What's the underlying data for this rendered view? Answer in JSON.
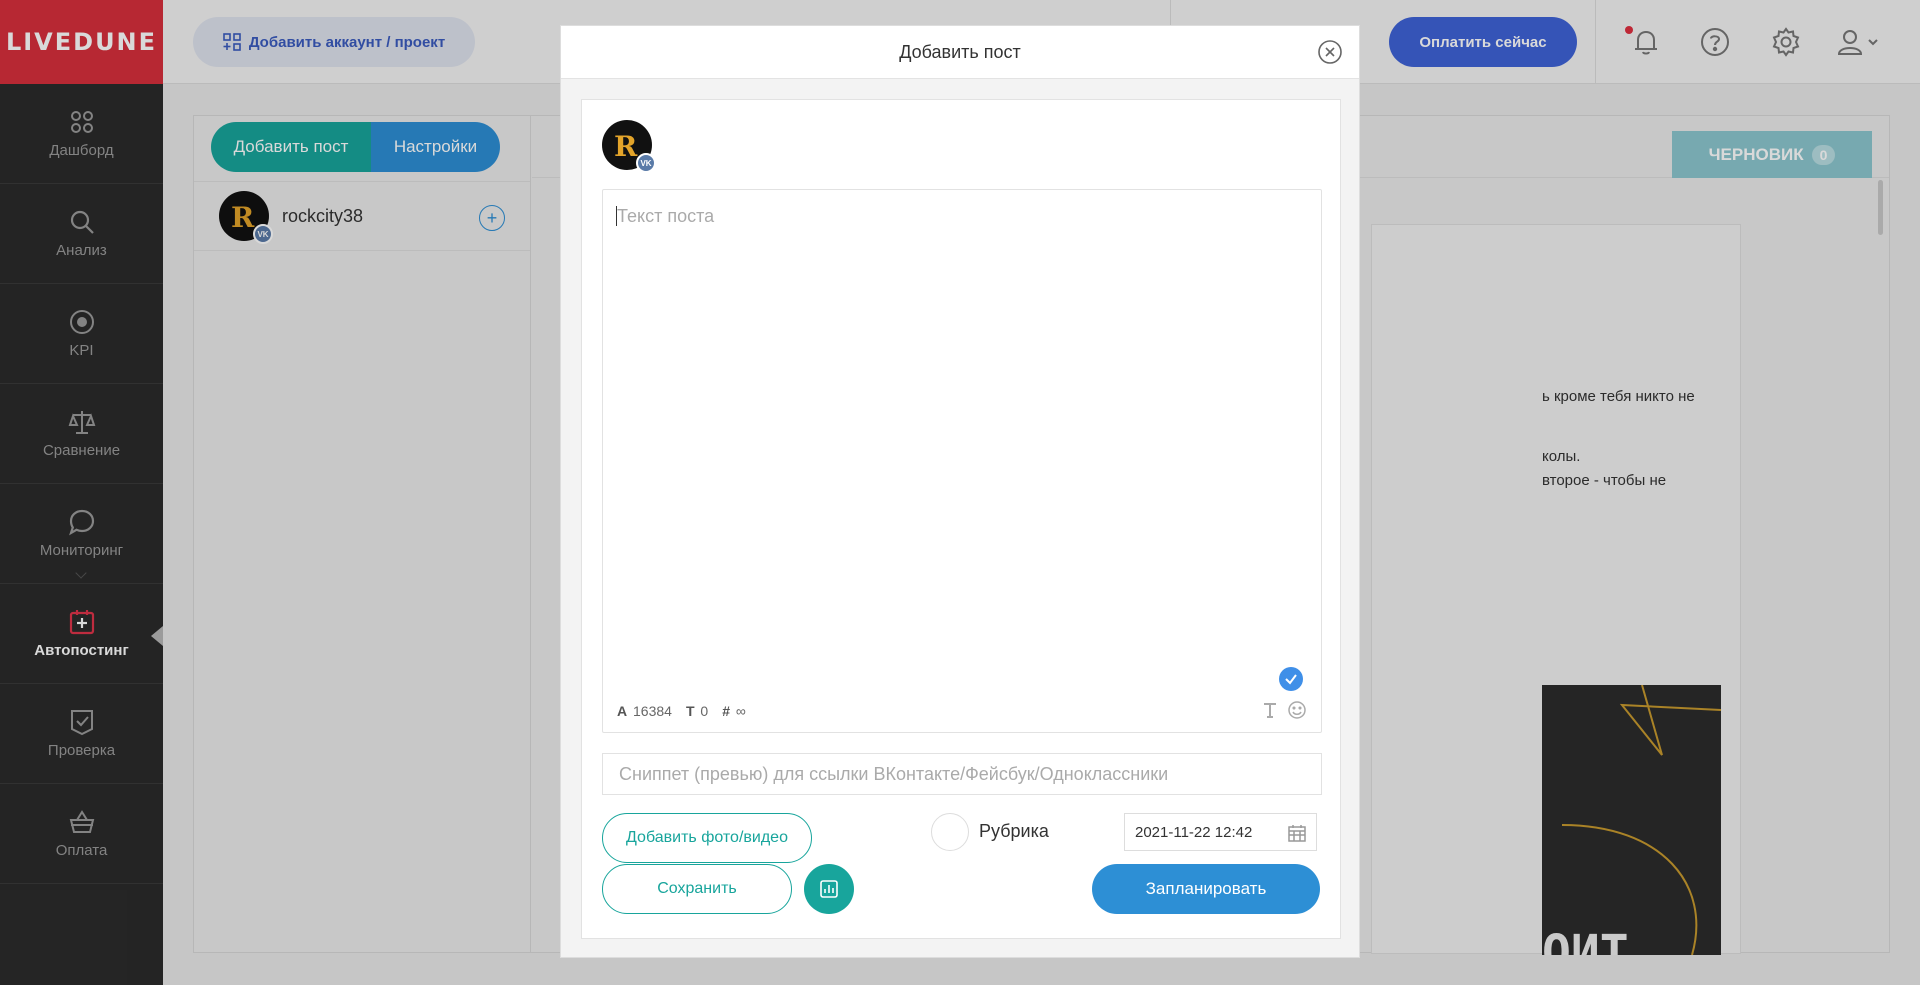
{
  "logo": "LIVEDUNE",
  "sidebar": {
    "items": [
      {
        "label": "Дашборд"
      },
      {
        "label": "Анализ"
      },
      {
        "label": "KPI"
      },
      {
        "label": "Сравнение"
      },
      {
        "label": "Мониторинг"
      },
      {
        "label": "Автопостинг"
      },
      {
        "label": "Проверка"
      },
      {
        "label": "Оплата"
      }
    ]
  },
  "header": {
    "add_account": "Добавить аккаунт / проект",
    "pay_now": "Оплатить сейчас"
  },
  "panel": {
    "tab_add_post": "Добавить пост",
    "tab_settings": "Настройки",
    "account_name": "rockcity38",
    "draft_label": "ЧЕРНОВИК",
    "draft_count": "0",
    "preview_lines": [
      "ь кроме тебя никто не",
      "колы.",
      "второе - чтобы не"
    ],
    "preview_image_text": "ОИТ"
  },
  "modal": {
    "title": "Добавить пост",
    "text_placeholder": "Текст поста",
    "counter_chars_label": "A",
    "counter_chars": "16384",
    "counter_tags_label": "T",
    "counter_tags": "0",
    "counter_hash_label": "#",
    "counter_hash": "∞",
    "snippet_placeholder": "Сниппет (превью) для ссылки ВКонтакте/Фейсбук/Одноклассники",
    "add_media": "Добавить фото/видео",
    "rubric": "Рубрика",
    "date": "2021-11-22 12:42",
    "save": "Сохранить",
    "schedule": "Запланировать",
    "vk_badge": "VK",
    "avatar_letter": "R"
  },
  "colors": {
    "teal": "#18a59c",
    "blue": "#2d8fd5",
    "brand_red": "#d7303c",
    "pay_blue": "#3f63d8"
  }
}
